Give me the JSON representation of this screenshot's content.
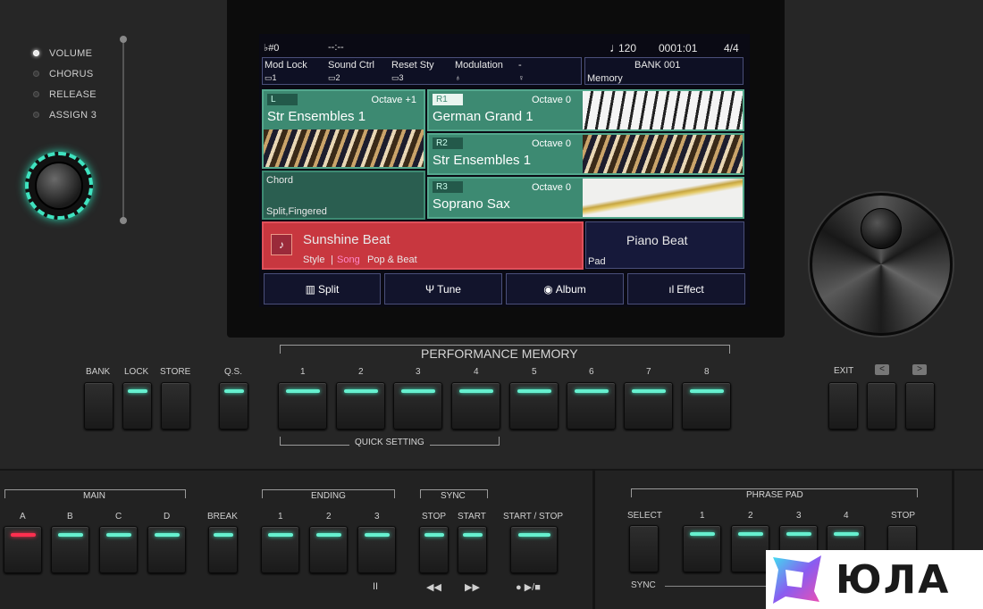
{
  "knob_panel": {
    "items": [
      "VOLUME",
      "CHORUS",
      "RELEASE",
      "ASSIGN 3"
    ]
  },
  "screen": {
    "status": {
      "key": "♭#0",
      "time": "--:--",
      "tempo_icon": "♩",
      "tempo": "120",
      "measure": "0001:01",
      "beat": "4/4"
    },
    "controls": [
      {
        "label": "Mod Lock",
        "sub": "▭1"
      },
      {
        "label": "Sound Ctrl",
        "sub": "▭2"
      },
      {
        "label": "Reset Sty",
        "sub": "▭3"
      },
      {
        "label": "Modulation",
        "sub": "♁"
      },
      {
        "label": "-",
        "sub": "♀"
      }
    ],
    "bank": {
      "title": "BANK 001",
      "sub": "Memory"
    },
    "left_part": {
      "tag": "L",
      "octave": "Octave +1",
      "name": "Str Ensembles 1"
    },
    "chord": {
      "title": "Chord",
      "mode": "Split,Fingered"
    },
    "right_parts": [
      {
        "tag": "R1",
        "octave": "Octave 0",
        "name": "German Grand 1"
      },
      {
        "tag": "R2",
        "octave": "Octave 0",
        "name": "Str Ensembles 1"
      },
      {
        "tag": "R3",
        "octave": "Octave 0",
        "name": "Soprano Sax"
      }
    ],
    "style": {
      "name": "Sunshine Beat",
      "mode": "Style",
      "sep": "|",
      "mode2": "Song",
      "category": "Pop & Beat"
    },
    "piano": {
      "name": "Piano Beat",
      "sub": "Pad"
    },
    "functions": [
      {
        "icon": "▥",
        "label": "Split"
      },
      {
        "icon": "Ψ",
        "label": "Tune"
      },
      {
        "icon": "◉",
        "label": "Album"
      },
      {
        "icon": "ıl",
        "label": "Effect"
      }
    ]
  },
  "panel": {
    "top_left_buttons": [
      "BANK",
      "LOCK",
      "STORE",
      "Q.S."
    ],
    "performance_memory": {
      "title": "PERFORMANCE MEMORY",
      "numbers": [
        "1",
        "2",
        "3",
        "4",
        "5",
        "6",
        "7",
        "8"
      ],
      "footer": "QUICK SETTING"
    },
    "exit": {
      "label": "EXIT",
      "prev": "<",
      "next": ">"
    },
    "main": {
      "title": "MAIN",
      "buttons": [
        "A",
        "B",
        "C",
        "D"
      ]
    },
    "break": "BREAK",
    "ending": {
      "title": "ENDING",
      "buttons": [
        "1",
        "2",
        "3"
      ]
    },
    "sync": {
      "title": "SYNC",
      "buttons": [
        "STOP",
        "START"
      ]
    },
    "start_stop": "START / STOP",
    "transport": {
      "pause": "II",
      "rew": "◀◀",
      "ff": "▶▶",
      "play": "● ▶/■"
    },
    "phrase_pad": {
      "title": "PHRASE PAD",
      "select": "SELECT",
      "buttons": [
        "1",
        "2",
        "3",
        "4"
      ],
      "stop": "STOP",
      "sync": "SYNC"
    }
  },
  "logo": {
    "text": "ЮЛА"
  },
  "colors": {
    "led": "#66f0cf",
    "led_red": "#ff2f4f",
    "part_green": "#3d8a72",
    "style_red": "#c8373f"
  }
}
